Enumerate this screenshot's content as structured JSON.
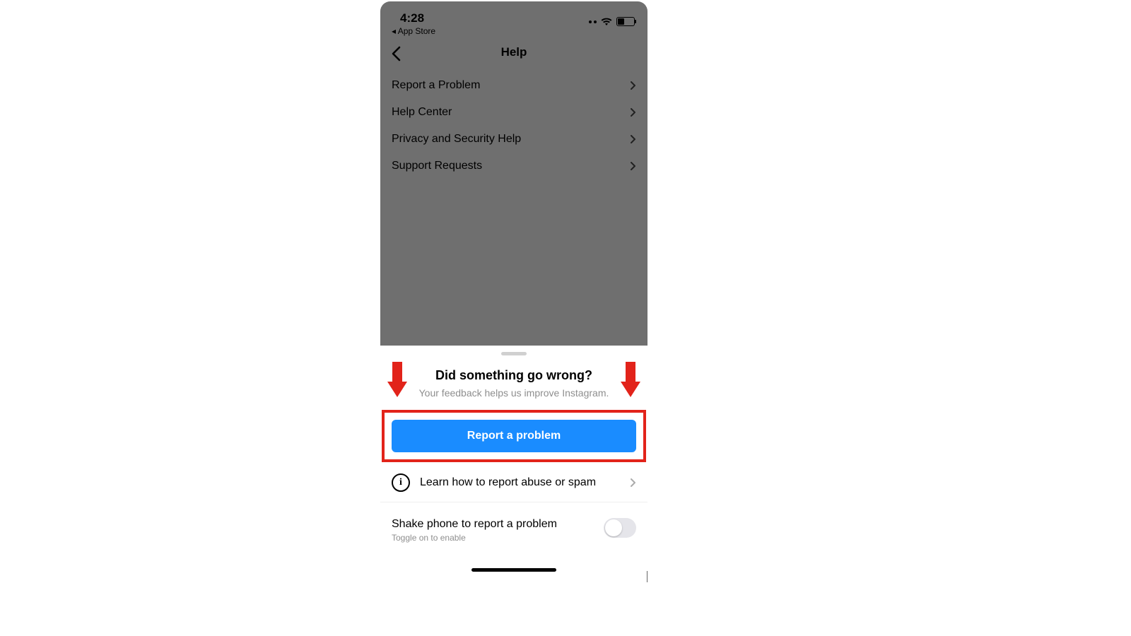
{
  "status": {
    "time": "4:28",
    "breadcrumb": " App Store"
  },
  "header": {
    "title": "Help"
  },
  "help_menu": [
    "Report a Problem",
    "Help Center",
    "Privacy and Security Help",
    "Support Requests"
  ],
  "sheet": {
    "title": "Did something go wrong?",
    "subtitle": "Your feedback helps us improve Instagram.",
    "report_button": "Report a problem",
    "learn_label": "Learn how to report abuse or spam",
    "shake": {
      "title": "Shake phone to report a problem",
      "subtitle": "Toggle on to enable",
      "enabled": false
    }
  },
  "annotation": {
    "highlight_color": "#E2231A",
    "arrow_color": "#E2231A"
  }
}
